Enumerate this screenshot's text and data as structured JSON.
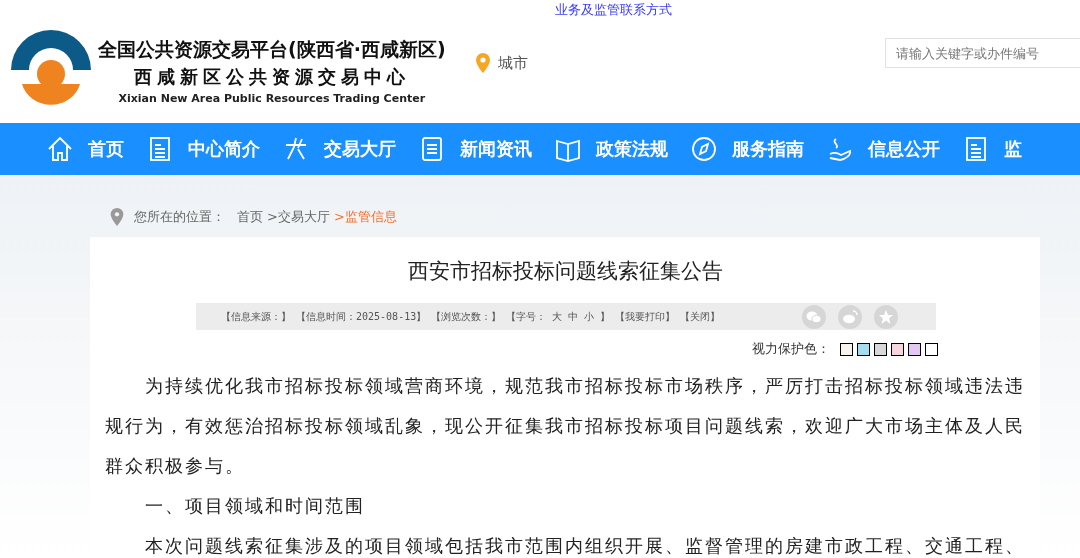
{
  "top_link": "业务及监管联系方式",
  "header": {
    "title": "全国公共资源交易平台(陕西省·西咸新区)",
    "subtitle": "西咸新区公共资源交易中心",
    "english": "Xixian New Area Public Resources Trading Center",
    "city": "城市",
    "search": {
      "placeholder": "请输入关键字或办件编号"
    }
  },
  "nav": [
    {
      "label": "首页"
    },
    {
      "label": "中心简介"
    },
    {
      "label": "交易大厅"
    },
    {
      "label": "新闻资讯"
    },
    {
      "label": "政策法规"
    },
    {
      "label": "服务指南"
    },
    {
      "label": "信息公开"
    },
    {
      "label": "监"
    }
  ],
  "breadcrumb": {
    "prefix": "您所在的位置：",
    "items": [
      {
        "label": "首页",
        "current": false
      },
      {
        "label": ">交易大厅",
        "current": false
      },
      {
        "label": ">监管信息",
        "current": true
      }
    ]
  },
  "article": {
    "title": "西安市招标投标问题线索征集公告",
    "meta": [
      {
        "kind": "text",
        "text": "【信息来源：】"
      },
      {
        "kind": "text",
        "text": "【信息时间：2025-08-13】"
      },
      {
        "kind": "text",
        "text": "【浏览次数：】"
      },
      {
        "kind": "sizes",
        "label": "【字号：",
        "options": [
          "大",
          "中",
          "小"
        ],
        "end": "】"
      },
      {
        "kind": "link",
        "text": "【我要打印】"
      },
      {
        "kind": "link",
        "text": "【关闭】"
      }
    ],
    "eye_label": "视力保护色：",
    "eye_colors": [
      {
        "color": "#f7f4ee"
      },
      {
        "color": "#a6dcf0"
      },
      {
        "color": "#d8d8d8"
      },
      {
        "color": "#f8d4dc"
      },
      {
        "color": "#e2c8f2"
      },
      {
        "color": "#ffffff"
      }
    ],
    "paragraphs": [
      "为持续优化我市招标投标领域营商环境，规范我市招标投标市场秩序，严厉打击招标投标领域违法违规行为，有效惩治招标投标领域乱象，现公开征集我市招标投标项目问题线索，欢迎广大市场主体及人民群众积极参与。",
      "一、项目领域和时间范围",
      "本次问题线索征集涉及的项目领域包括我市范围内组织开展、监督管理的房建市政工程、交通工程、"
    ]
  }
}
